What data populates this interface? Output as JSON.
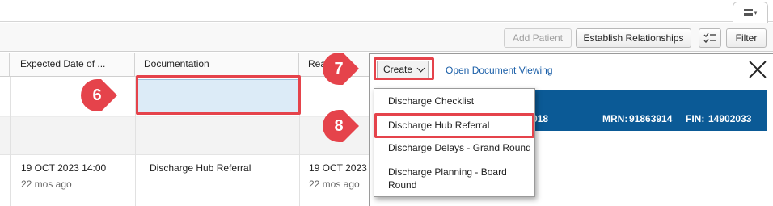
{
  "toolbar": {
    "add_patient": "Add Patient",
    "establish_relationships": "Establish Relationships",
    "filter": "Filter"
  },
  "grid": {
    "columns": {
      "expected_date": "Expected Date of ...",
      "documentation": "Documentation",
      "ready": "Rea"
    },
    "row": {
      "expected_date": "19 OCT 2023 14:00",
      "expected_ago": "22 mos ago",
      "documentation": "Discharge Hub Referral",
      "ready_date": "19 OCT 2023",
      "ready_ago": "22 mos ago"
    }
  },
  "panel": {
    "create_label": "Create",
    "open_document_viewing": "Open Document Viewing",
    "banner": {
      "partial": "018",
      "mrn_label": "MRN:",
      "mrn": "91863914",
      "fin_label": "FIN:",
      "fin": "14902033"
    },
    "create_menu": [
      "Discharge Checklist",
      "Discharge Hub Referral",
      "Discharge Delays - Grand Round",
      "Discharge Planning - Board",
      "Round"
    ]
  },
  "callouts": [
    "6",
    "7",
    "8"
  ],
  "colors": {
    "callout": "#e5434b",
    "banner": "#0b5a96",
    "selected_cell": "#dcebf7",
    "link": "#1b5fa8"
  },
  "icons": {
    "menu": "hamburger-dropdown-icon",
    "checklist": "checklist-icon",
    "close": "close-icon",
    "create_chevron": "chevron-down-icon"
  }
}
